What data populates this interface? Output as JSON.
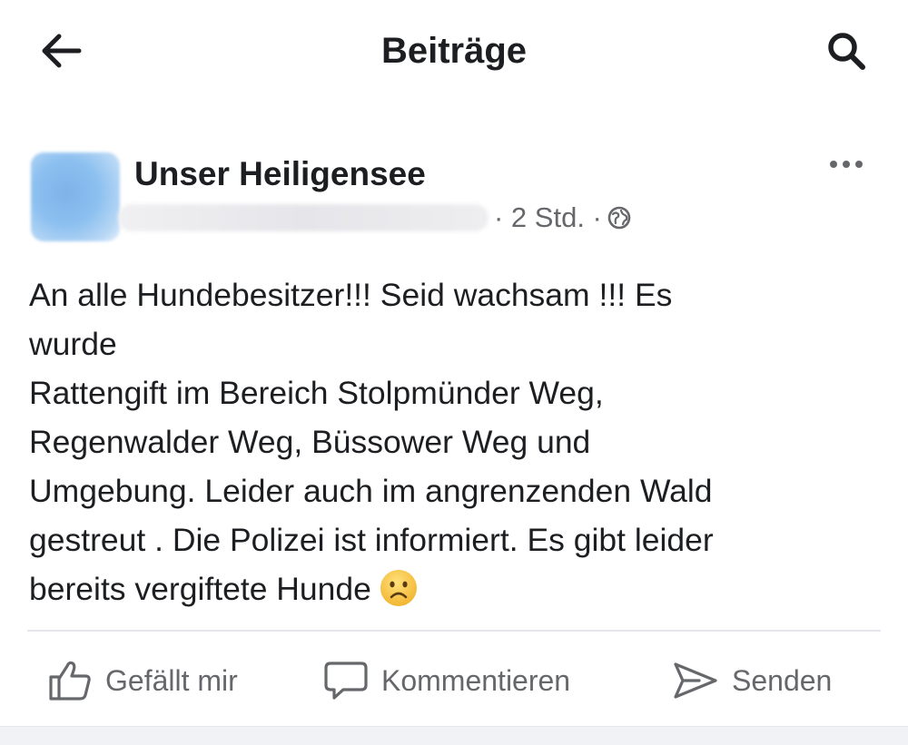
{
  "header": {
    "title": "Beiträge",
    "back_icon": "arrow-left-icon",
    "search_icon": "search-icon"
  },
  "post": {
    "page_name": "Unser Heiligensee",
    "meta_time": "· 2 Std. ·",
    "privacy_icon": "globe-icon",
    "more_icon": "more-dots-icon",
    "text_lines": [
      "An alle Hundebesitzer!!! Seid wachsam !!! Es",
      "wurde",
      "Rattengift im Bereich Stolpmünder Weg,",
      "Regenwalder  Weg, Büssower Weg und",
      "Umgebung.  Leider auch im angrenzenden Wald",
      "gestreut . Die Polizei ist informiert. Es gibt leider",
      "bereits vergiftete Hunde"
    ],
    "emoji": "frowning-face-emoji"
  },
  "actions": {
    "like_label": "Gefällt mir",
    "comment_label": "Kommentieren",
    "send_label": "Senden"
  },
  "colors": {
    "text": "#1c1e21",
    "secondary_text": "#65676b",
    "divider": "#e4e6eb",
    "emoji_yellow": "#f7c84a"
  }
}
